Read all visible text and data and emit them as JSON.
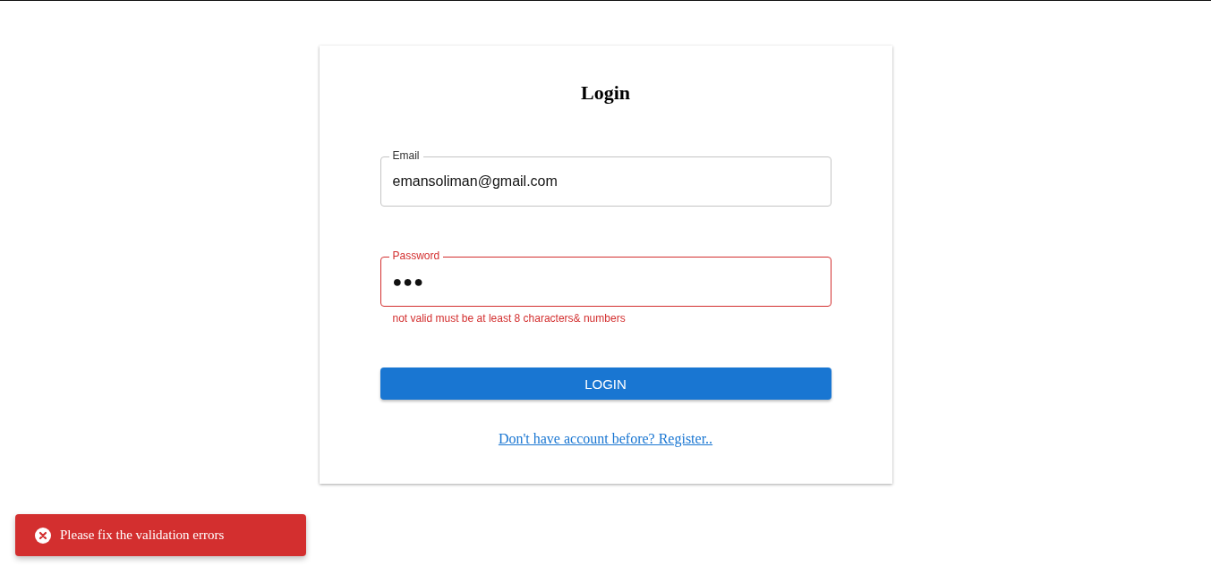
{
  "form": {
    "title": "Login",
    "fields": [
      {
        "kind": "text",
        "label": "Email",
        "value": "emansoliman@gmail.com",
        "error": false
      },
      {
        "kind": "password",
        "label": "Password",
        "value": "●●●",
        "error": true,
        "helper": "not valid must be at least 8 characters& numbers"
      }
    ],
    "submit": "LOGIN",
    "link": "Don't have account before? Register.."
  },
  "toast": {
    "kind": "error",
    "message": "Please fix the validation errors"
  }
}
